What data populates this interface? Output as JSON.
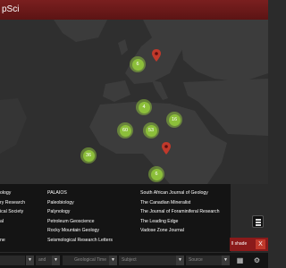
{
  "header": {
    "title": "pSci"
  },
  "map": {
    "clusters": [
      {
        "label": "6"
      },
      {
        "label": "4"
      },
      {
        "label": "16"
      },
      {
        "label": "60"
      },
      {
        "label": "53"
      },
      {
        "label": "36"
      },
      {
        "label": "6"
      }
    ],
    "cluster_color": "#8cbf3a",
    "pin_color": "#c0392b"
  },
  "journals": {
    "col1": [
      "ology",
      "ry Research",
      "ical Society",
      "al",
      "ne"
    ],
    "col2": [
      "PALAIOS",
      "Paleobiology",
      "Palynology",
      "Petroleum Geoscience",
      "Rocky Mountain Geology",
      "Seismological Research Letters"
    ],
    "col3": [
      "South African Journal of Geology",
      "The Canadian Mineralist",
      "The Journal of Foraminiferal Research",
      "The Leading Edge",
      "Vadose Zone Journal"
    ]
  },
  "shade": {
    "label": "ll shade",
    "close_label": "X"
  },
  "toolbar": {
    "op1": "and",
    "geological_time_placeholder": "Geological Time",
    "subject_placeholder": "Subject",
    "source_placeholder": "Source"
  },
  "colors": {
    "header": "#7a1f1f",
    "panel": "#141414",
    "accent": "#8b1a1a"
  }
}
